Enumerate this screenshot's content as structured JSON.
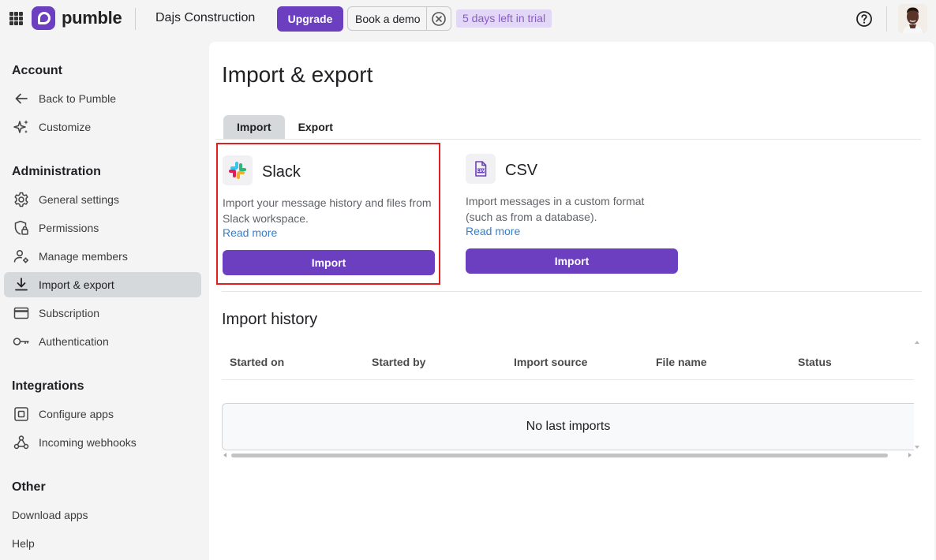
{
  "topbar": {
    "brand": "pumble",
    "workspace": "Dajs Construction",
    "upgrade_label": "Upgrade",
    "book_demo_label": "Book a demo",
    "trial_badge": "5 days left in trial",
    "help_icon": "question-circle-icon",
    "close_icon": "close-circle-icon"
  },
  "sidebar": {
    "sections": [
      {
        "title": "Account",
        "items": [
          {
            "label": "Back to Pumble",
            "icon": "arrow-left-icon"
          },
          {
            "label": "Customize",
            "icon": "sparkle-icon"
          }
        ]
      },
      {
        "title": "Administration",
        "items": [
          {
            "label": "General settings",
            "icon": "gear-icon"
          },
          {
            "label": "Permissions",
            "icon": "shield-lock-icon"
          },
          {
            "label": "Manage members",
            "icon": "user-gear-icon"
          },
          {
            "label": "Import & export",
            "icon": "download-icon",
            "active": true
          },
          {
            "label": "Subscription",
            "icon": "credit-card-icon"
          },
          {
            "label": "Authentication",
            "icon": "key-icon"
          }
        ]
      },
      {
        "title": "Integrations",
        "items": [
          {
            "label": "Configure apps",
            "icon": "puzzle-icon"
          },
          {
            "label": "Incoming webhooks",
            "icon": "webhook-icon"
          }
        ]
      },
      {
        "title": "Other",
        "items": [
          {
            "label": "Download apps"
          },
          {
            "label": "Help"
          }
        ]
      }
    ]
  },
  "main": {
    "title": "Import & export",
    "tabs": [
      {
        "label": "Import",
        "active": true
      },
      {
        "label": "Export",
        "active": false
      }
    ],
    "cards": [
      {
        "name": "Slack",
        "icon": "slack-logo-icon",
        "description": "Import your message history and files from Slack workspace.",
        "link": "Read more",
        "button": "Import",
        "selected": true
      },
      {
        "name": "CSV",
        "icon": "csv-file-icon",
        "description": "Import messages in a custom format (such as from a database).",
        "link": "Read more",
        "button": "Import",
        "selected": false
      }
    ],
    "history": {
      "title": "Import history",
      "columns": [
        "Started on",
        "Started by",
        "Import source",
        "File name",
        "Status"
      ],
      "empty_message": "No last imports"
    }
  },
  "colors": {
    "accent": "#6b3fbf",
    "link": "#2e7fd6",
    "trial_badge_bg": "#e2d7f5",
    "selection_border": "#e02020",
    "active_nav_bg": "#d5d9dc"
  }
}
